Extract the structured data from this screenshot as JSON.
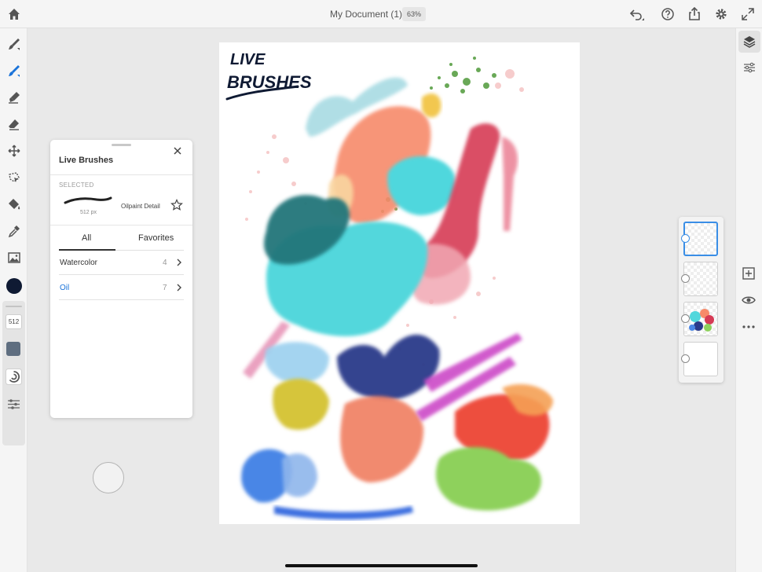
{
  "header": {
    "document_title": "My Document (1)",
    "zoom": "63%"
  },
  "left_toolbar": {
    "brush_size": "512",
    "current_color": "#0f1a33"
  },
  "brushes_panel": {
    "title": "Live Brushes",
    "selected_label": "SELECTED",
    "selected_brush": {
      "name": "Oilpaint Detail",
      "size": "512 px"
    },
    "tabs": [
      {
        "label": "All",
        "active": true
      },
      {
        "label": "Favorites",
        "active": false
      }
    ],
    "categories": [
      {
        "label": "Watercolor",
        "count": "4",
        "active": false
      },
      {
        "label": "Oil",
        "count": "7",
        "active": true
      }
    ]
  },
  "colors": {
    "accent": "#1a73d9",
    "selection": "#3a8ee6"
  },
  "canvas": {
    "handwriting": [
      "LIVE",
      "BRUSHES"
    ]
  },
  "layers": {
    "count": 4,
    "active_index": 0
  }
}
